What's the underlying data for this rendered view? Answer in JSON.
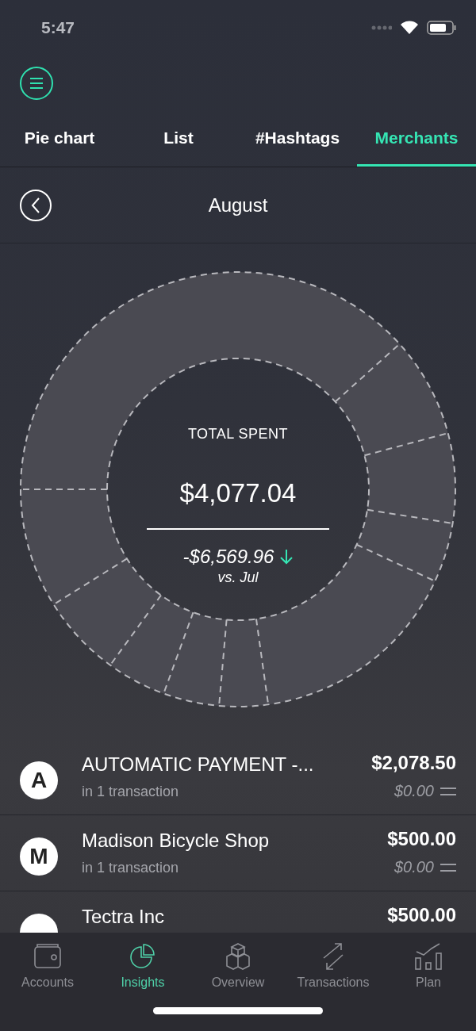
{
  "status_bar": {
    "time": "5:47"
  },
  "tabs": [
    {
      "label": "Pie chart",
      "selected": false
    },
    {
      "label": "List",
      "selected": false
    },
    {
      "label": "#Hashtags",
      "selected": false
    },
    {
      "label": "Merchants",
      "selected": true
    }
  ],
  "period": {
    "title": "August"
  },
  "summary": {
    "label": "TOTAL SPENT",
    "total": "$4,077.04",
    "change": "-$6,569.96",
    "comparison": "vs. Jul",
    "decreased": true
  },
  "merchants": [
    {
      "initial": "A",
      "name": "AUTOMATIC PAYMENT -...",
      "count": "in 1 transaction",
      "amount": "$2,078.50",
      "change": "$0.00"
    },
    {
      "initial": "M",
      "name": "Madison Bicycle Shop",
      "count": "in 1 transaction",
      "amount": "$500.00",
      "change": "$0.00"
    },
    {
      "name": "Tectra Inc",
      "amount": "$500.00"
    }
  ],
  "bottom_nav": [
    {
      "label": "Accounts",
      "selected": false
    },
    {
      "label": "Insights",
      "selected": true
    },
    {
      "label": "Overview",
      "selected": false
    },
    {
      "label": "Transactions",
      "selected": false
    },
    {
      "label": "Plan",
      "selected": false
    }
  ]
}
